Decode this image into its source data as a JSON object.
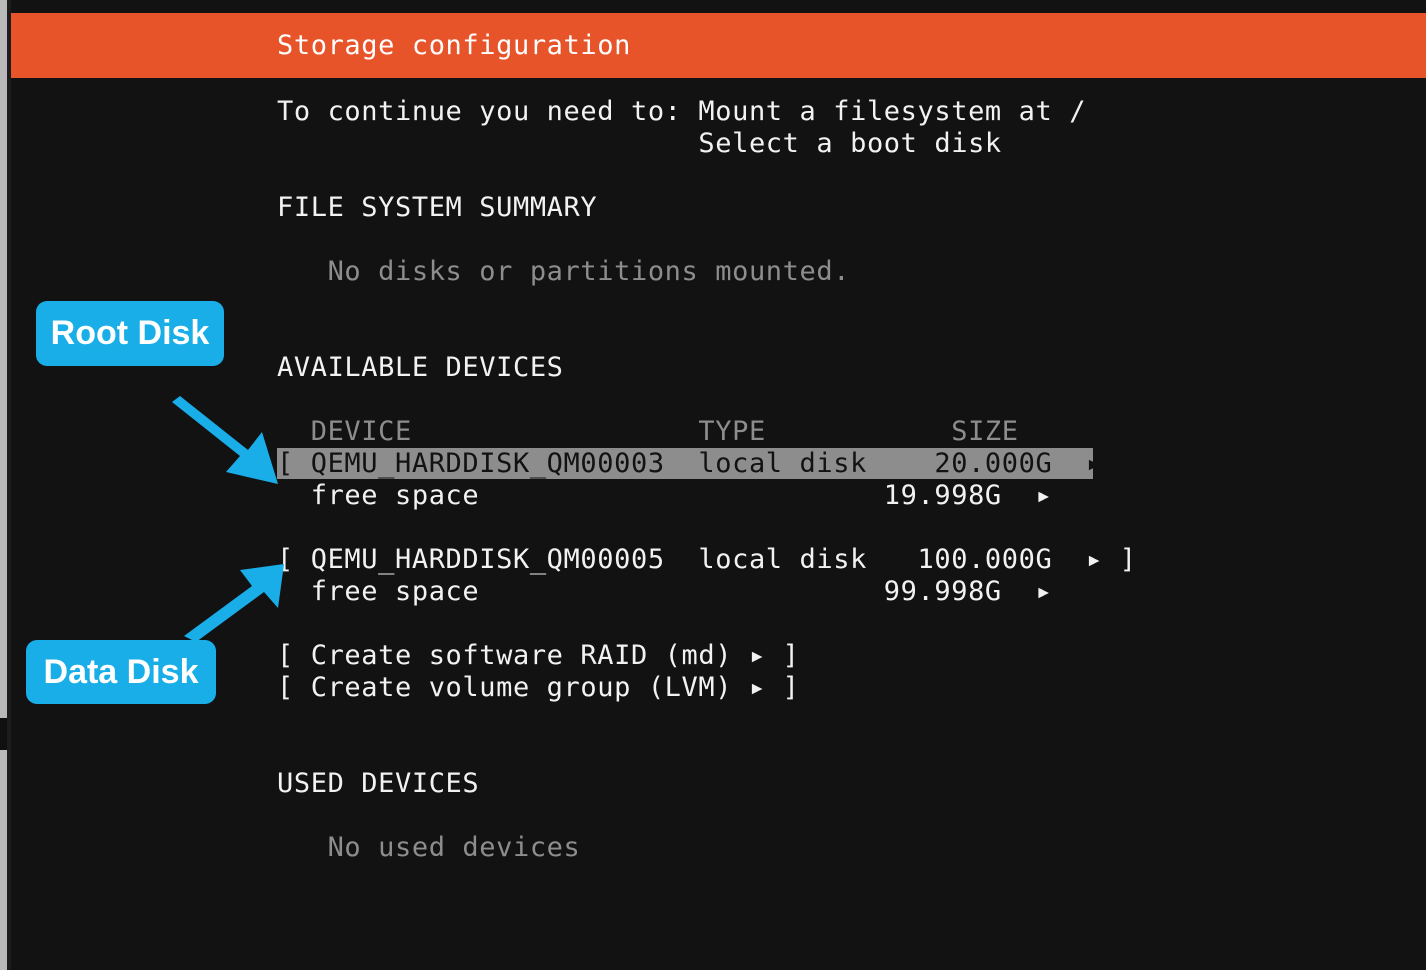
{
  "window": {
    "title": "Storage configuration",
    "title_bar_color": "#e8542a",
    "background_color": "#121212",
    "text_color": "#f2f2f2",
    "dim_text_color": "#8d8d8d",
    "highlight_color": "#8d8d8d",
    "callout_color": "#19aee8"
  },
  "instructions": {
    "line1": "To continue you need to: Mount a filesystem at /",
    "line2": "                         Select a boot disk"
  },
  "file_system_summary": {
    "heading": "FILE SYSTEM SUMMARY",
    "empty_message": "   No disks or partitions mounted."
  },
  "available_devices": {
    "heading": "AVAILABLE DEVICES",
    "columns": {
      "line": "  DEVICE                 TYPE           SIZE",
      "device": "DEVICE",
      "type": "TYPE",
      "size": "SIZE"
    },
    "rows": [
      {
        "kind": "device",
        "selected": true,
        "bracket_open": "[ ",
        "name": "QEMU_HARDDISK_QM00003",
        "type": "local disk",
        "size": "20.000G",
        "arrow": "▸",
        "bracket_close": " ]",
        "line": "[ QEMU_HARDDISK_QM00003  local disk    20.000G  ▸ ]"
      },
      {
        "kind": "free",
        "selected": false,
        "name": "free space",
        "size": "19.998G",
        "arrow": "▸",
        "line": "  free space                        19.998G  ▸"
      },
      {
        "kind": "device",
        "selected": false,
        "bracket_open": "[ ",
        "name": "QEMU_HARDDISK_QM00005",
        "type": "local disk",
        "size": "100.000G",
        "arrow": "▸",
        "bracket_close": " ]",
        "line": "[ QEMU_HARDDISK_QM00005  local disk   100.000G  ▸ ]"
      },
      {
        "kind": "free",
        "selected": false,
        "name": "free space",
        "size": "99.998G",
        "arrow": "▸",
        "line": "  free space                        99.998G  ▸"
      }
    ],
    "actions": [
      {
        "label": "Create software RAID (md)",
        "line": "[ Create software RAID (md) ▸ ]"
      },
      {
        "label": "Create volume group (LVM)",
        "line": "[ Create volume group (LVM) ▸ ]"
      }
    ]
  },
  "used_devices": {
    "heading": "USED DEVICES",
    "empty_message": "   No used devices"
  },
  "callouts": [
    {
      "label": "Root Disk",
      "points_to": "QEMU_HARDDISK_QM00003",
      "direction": "down-right"
    },
    {
      "label": "Data Disk",
      "points_to": "QEMU_HARDDISK_QM00005",
      "direction": "up-right"
    }
  ]
}
